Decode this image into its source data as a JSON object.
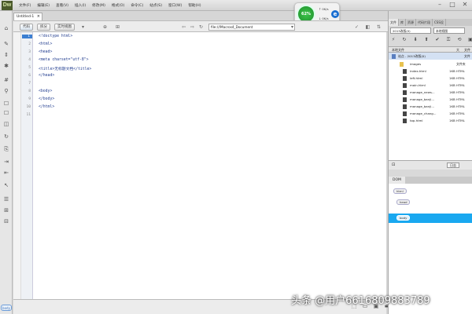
{
  "app": {
    "logo": "Dw",
    "menus": [
      "文件(F)",
      "编辑(E)",
      "查看(V)",
      "插入(I)",
      "修改(M)",
      "格式(O)",
      "命令(C)",
      "站点(S)",
      "窗口(W)",
      "帮助(H)"
    ],
    "window_buttons": [
      "–",
      "□",
      "✕"
    ]
  },
  "perf_widget": {
    "cpu": "62%",
    "up_arrow": "↑",
    "down_arrow": "↓",
    "up_speed": "0K/s",
    "down_speed": "0K/s",
    "ie_letter": "e"
  },
  "document": {
    "tab_label": "Untitled-1",
    "tab_close": "×",
    "path": "X:\\Untitled-1",
    "views": [
      "代码",
      "拆分",
      "实时视图"
    ],
    "address": "file:///Macros4_Document"
  },
  "editor": {
    "line_numbers": [
      "1",
      "2",
      "3",
      "4",
      "5",
      "6",
      "7",
      "8",
      "9",
      "10",
      "11"
    ],
    "lines": [
      "<!doctype html>",
      "<html>",
      "<head>",
      "<meta charset=\"utf-8\">",
      "<title>无标题文档</title>",
      "</head>",
      "",
      "<body>",
      "</body>",
      "</html>",
      ""
    ]
  },
  "status": {
    "tag": "body"
  },
  "files_panel": {
    "tabs": [
      "文件",
      "库",
      "资源",
      "代码片段",
      "CSS设"
    ],
    "site_select": "2013改版(0)",
    "view_select": "本地视图",
    "header_left": "本地文件",
    "header_right": "大",
    "header_type": "文件",
    "site_row": "站点 - 2013改版(0)",
    "site_type": "文件",
    "rows": [
      {
        "name": "images",
        "size": "",
        "type": "文件夹"
      },
      {
        "name": "index.html",
        "size": "1KB",
        "type": "HTML"
      },
      {
        "name": "left.html",
        "size": "1KB",
        "type": "HTML"
      },
      {
        "name": "main.html",
        "size": "1KB",
        "type": "HTML"
      },
      {
        "name": "manage_news...",
        "size": "1KB",
        "type": "HTML"
      },
      {
        "name": "manage_banji...",
        "size": "1KB",
        "type": "HTML"
      },
      {
        "name": "manage_banji...",
        "size": "1KB",
        "type": "HTML"
      },
      {
        "name": "manage_chang...",
        "size": "1KB",
        "type": "HTML"
      },
      {
        "name": "top.html",
        "size": "1KB",
        "type": "HTML"
      }
    ],
    "log_button": "日志"
  },
  "dom_panel": {
    "tab": "DOM",
    "nodes": [
      "html",
      "head",
      "body"
    ]
  },
  "watermark": "头条 @用户6616809883789",
  "colors": {
    "selection": "#19a8f0",
    "active_line": "#3c7fd1",
    "cpu_green": "#2aa83a"
  }
}
